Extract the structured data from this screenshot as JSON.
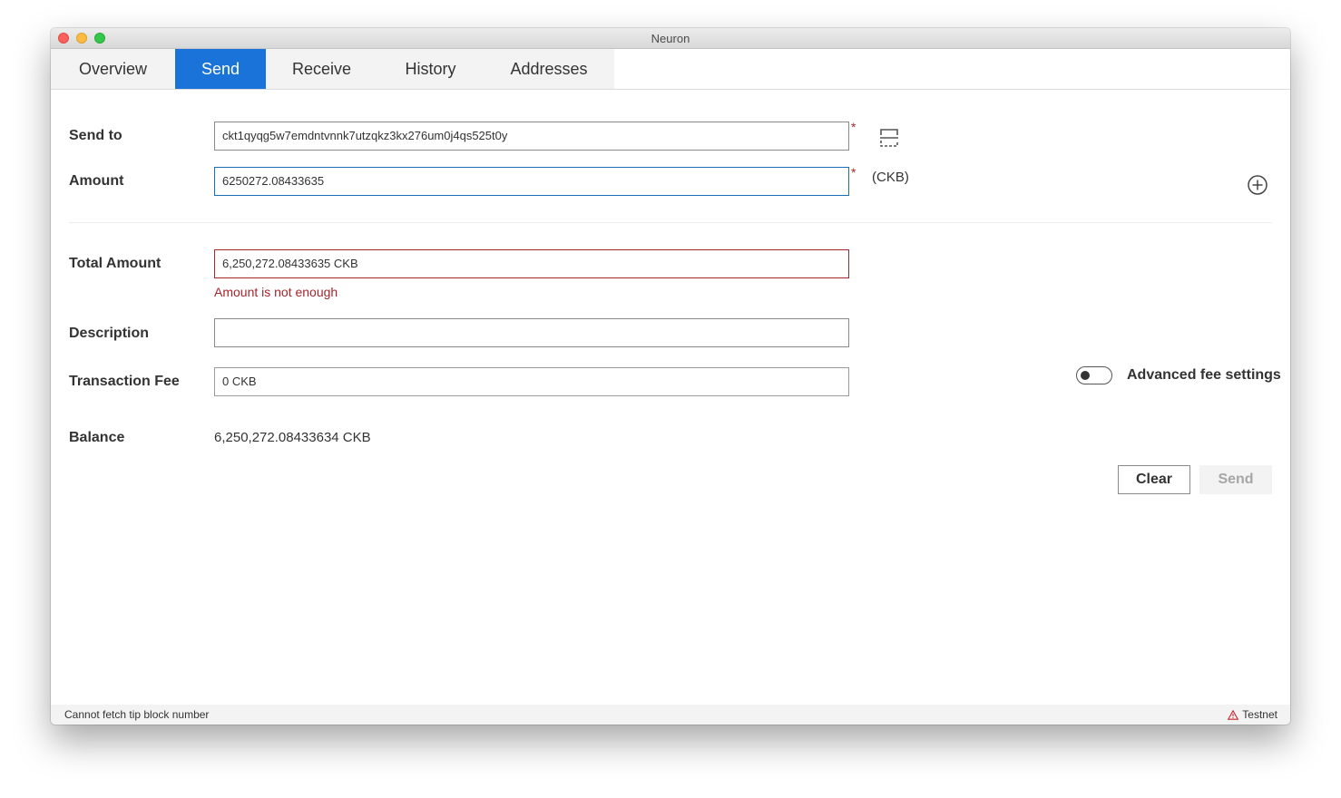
{
  "window": {
    "title": "Neuron"
  },
  "tabs": [
    {
      "label": "Overview",
      "active": false
    },
    {
      "label": "Send",
      "active": true
    },
    {
      "label": "Receive",
      "active": false
    },
    {
      "label": "History",
      "active": false
    },
    {
      "label": "Addresses",
      "active": false
    }
  ],
  "form": {
    "send_to": {
      "label": "Send to",
      "value": "ckt1qyqg5w7emdntvnnk7utzqkz3kx276um0j4qs525t0y",
      "required_mark": "*"
    },
    "amount": {
      "label": "Amount",
      "value": "6250272.08433635",
      "required_mark": "*",
      "unit": "(CKB)"
    },
    "total_amount": {
      "label": "Total Amount",
      "value": "6,250,272.08433635 CKB",
      "error": "Amount is not enough"
    },
    "description": {
      "label": "Description",
      "value": ""
    },
    "transaction_fee": {
      "label": "Transaction Fee",
      "value": "0 CKB"
    },
    "advanced_fee": {
      "label": "Advanced fee settings",
      "enabled": false
    },
    "balance": {
      "label": "Balance",
      "value": "6,250,272.08433634 CKB"
    }
  },
  "buttons": {
    "clear_label": "Clear",
    "send_label": "Send",
    "send_disabled": true
  },
  "statusbar": {
    "left_text": "Cannot fetch tip block number",
    "network": "Testnet"
  },
  "icons": {
    "scan": "scan-icon",
    "add": "add-circle-icon",
    "warning": "warning-icon"
  },
  "colors": {
    "accent": "#1a73d9",
    "error": "#a4262c",
    "tab_bar": "#f3f3f3"
  }
}
